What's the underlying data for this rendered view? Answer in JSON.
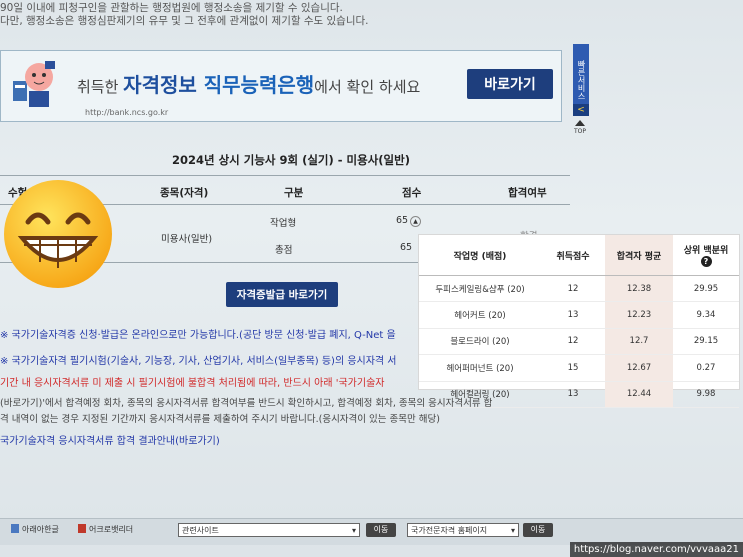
{
  "notice_top": {
    "line1": "90일 이내에 피청구인을 관할하는 행정법원에 행정소송을 제기할 수 있습니다.",
    "line2": "다만, 행정소송은 행정심판제기의 유무 및 그 전후에 관계없이 제기할 수도 있습니다."
  },
  "banner": {
    "part1": "취득한 ",
    "part2": "자격정보",
    "part3": " 직무능력은행",
    "part4": "에서 확인 하세요",
    "button": "바로가기",
    "url": "http://bank.ncs.go.kr"
  },
  "side": {
    "label": "빠른서비스",
    "arrow": "<",
    "top": "TOP"
  },
  "result": {
    "title": "2024년 상시 기능사 9회 (실기) - 미용사(일반)",
    "headers": [
      "수험",
      "종목(자격)",
      "구분",
      "점수",
      "합격여부"
    ],
    "subject": "미용사(일반)",
    "rows": [
      {
        "label": "작업형",
        "score": "65"
      },
      {
        "label": "총점",
        "score": "65"
      }
    ],
    "pass": "합격",
    "button": "자격증발급 바로가기"
  },
  "notices": {
    "n1": "※ 국가기술자격증 신청·발급은 온라인으로만 가능합니다.(공단 방문 신청·발급 폐지, Q-Net 을",
    "n2": "※ 국가기술자격 필기시험(기술사, 기능장, 기사, 산업기사, 서비스(일부종목) 등)의 응시자격 서",
    "n3": "기간 내 응시자격서류 미 제출 시 필기시험에 불합격 처리됨에 따라, 반드시 아래 '국가기술자",
    "n4": "(바로가기)'에서 합격예정 회차, 종목의 응시자격서류 합격여부를 반드시 확인하시고, 합격예정 회차, 종목의 응시자격서류 합",
    "n5": "격 내역이 없는 경우 지정된 기간까지 응시자격서류를 제출하여 주시기 바랍니다.(응시자격이 있는 종목만 해당)",
    "n6": "국가기술자격 응시자격서류 합격 결과안내(바로가기)"
  },
  "bottom": {
    "b1": "아래아한글",
    "b2": "어크로뱃리더",
    "related": "관련사이트",
    "go1": "이동",
    "national": "국가전문자격 홈페이지",
    "go2": "이동"
  },
  "overlay": {
    "headers": [
      "작업명 (배점)",
      "취득점수",
      "합격자 평균",
      "상위 백분위"
    ],
    "rows": [
      {
        "name": "두피스케일링&샴푸 (20)",
        "score": "12",
        "avg": "12.38",
        "pct": "29.95"
      },
      {
        "name": "헤어커트 (20)",
        "score": "13",
        "avg": "12.23",
        "pct": "9.34"
      },
      {
        "name": "블로드라이 (20)",
        "score": "12",
        "avg": "12.7",
        "pct": "29.15"
      },
      {
        "name": "헤어퍼머넌트 (20)",
        "score": "15",
        "avg": "12.67",
        "pct": "0.27"
      },
      {
        "name": "헤어컬러링 (20)",
        "score": "13",
        "avg": "12.44",
        "pct": "9.98"
      }
    ],
    "help": "?"
  },
  "watermark": "https://blog.naver.com/vvvaaa21",
  "colors": {
    "navy": "#1e3e7d",
    "link_blue": "#2338a8",
    "red": "#d12a2a",
    "shade": "#f4e9e4"
  }
}
